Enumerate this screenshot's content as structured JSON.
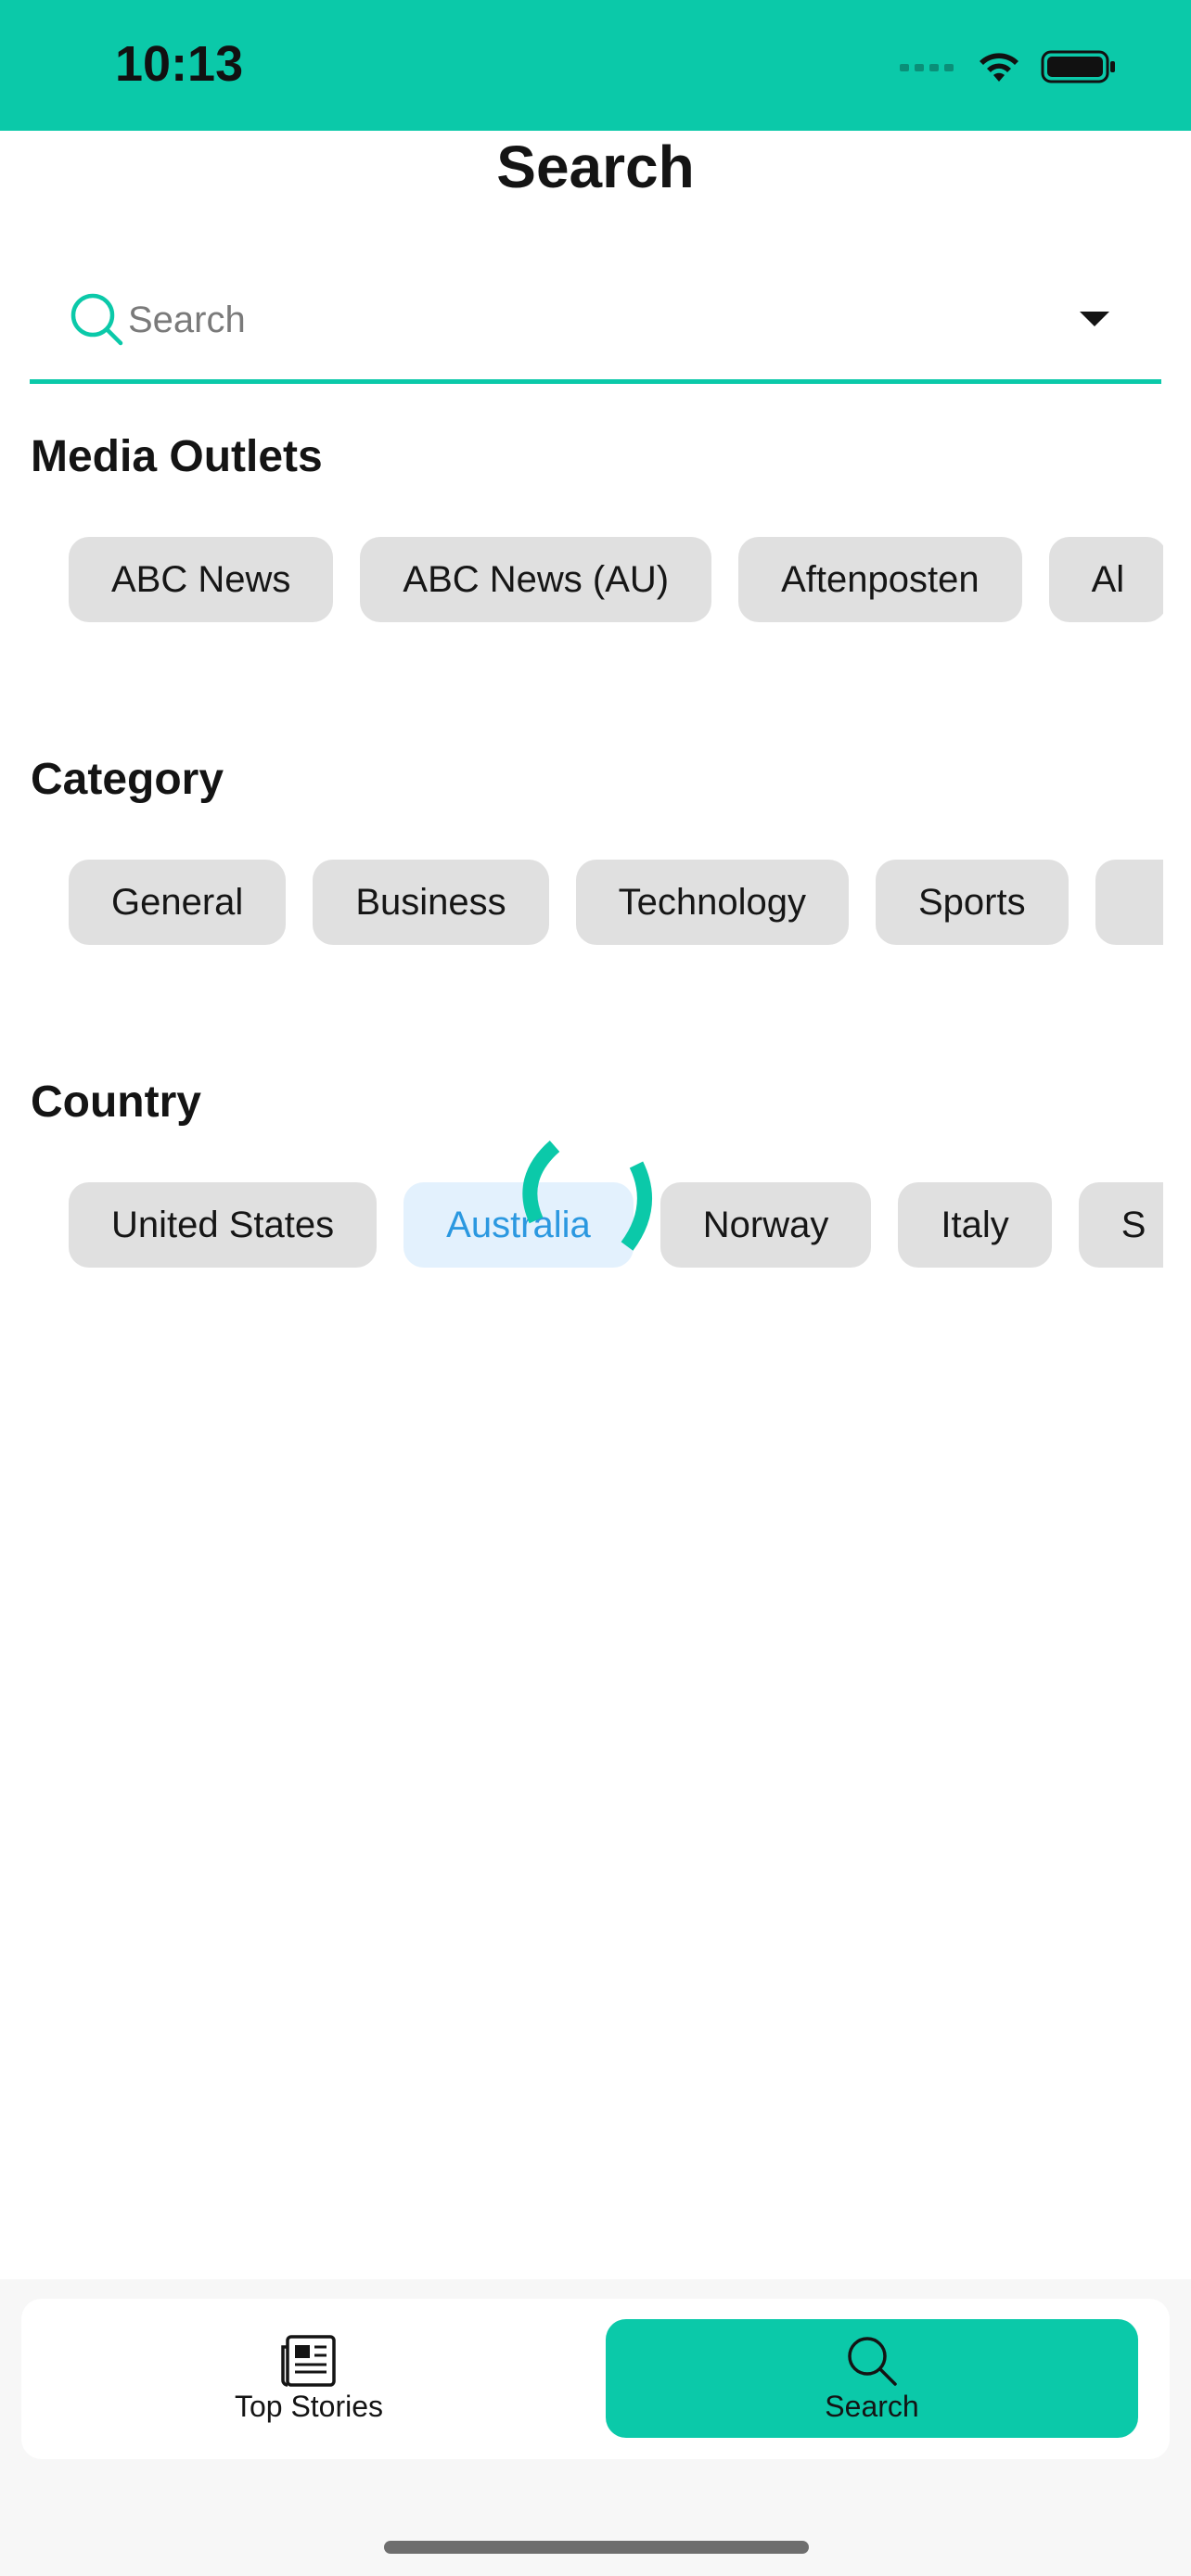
{
  "status_bar": {
    "time": "10:13",
    "background": "#0BC9A9"
  },
  "header": {
    "title": "Search"
  },
  "search": {
    "placeholder": "Search",
    "value": "",
    "accent": "#0BC9A9"
  },
  "sections": {
    "media_outlets": {
      "title": "Media Outlets",
      "chips": [
        "ABC News",
        "ABC News (AU)",
        "Aftenposten",
        "Al"
      ]
    },
    "category": {
      "title": "Category",
      "chips": [
        "General",
        "Business",
        "Technology",
        "Sports",
        ""
      ]
    },
    "country": {
      "title": "Country",
      "chips": [
        "United States",
        "Australia",
        "Norway",
        "Italy",
        "S"
      ],
      "selected": "Australia"
    }
  },
  "tabs": [
    {
      "label": "Top Stories",
      "icon": "newspaper-icon",
      "active": false
    },
    {
      "label": "Search",
      "icon": "search-icon",
      "active": true
    }
  ],
  "colors": {
    "accent": "#0BC9A9",
    "chip_bg": "#E0E0E0",
    "selected_chip_bg": "#E3F1FD",
    "selected_chip_text": "#2B98E0"
  }
}
